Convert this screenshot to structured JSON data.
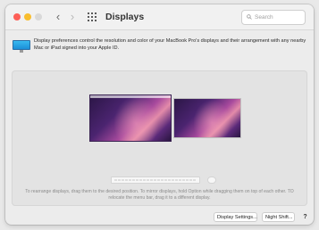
{
  "window": {
    "title": "Displays",
    "traffic_lights": [
      "close",
      "minimize",
      "zoom"
    ]
  },
  "toolbar": {
    "back_glyph": "‹",
    "forward_glyph": "›",
    "grid_icon": "grid-icon"
  },
  "search": {
    "placeholder": "Search",
    "value": ""
  },
  "description": "Display preferences control the resolution and color of your MacBook Pro's displays and their arrangement with any nearby Mac or iPad signed into your Apple ID.",
  "arrangement": {
    "displays": [
      {
        "name": "display-1",
        "primary": true
      },
      {
        "name": "display-2",
        "primary": false
      }
    ],
    "hint": "To rearrange displays, drag them to the desired position. To mirror displays, hold Option while dragging them on top of each other. TO relocate the menu bar, drag it to a different display."
  },
  "buttons": {
    "display_settings": "Display Settings...",
    "night_shift": "Night Shift...",
    "help": "?"
  },
  "colors": {
    "close": "#fd5f57",
    "minimize": "#f8bd2e",
    "zoom": "#d9d9d9",
    "pref_icon": "#1b8fd8"
  }
}
